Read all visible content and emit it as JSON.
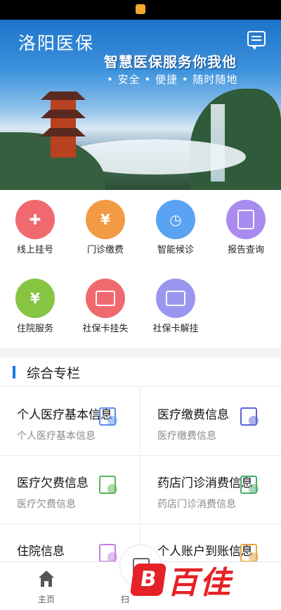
{
  "app": {
    "title": "洛阳医保"
  },
  "banner": {
    "slogan": "智慧医保服务你我他",
    "tags": "• 安全 • 便捷 • 随时随地"
  },
  "services": [
    {
      "label": "线上挂号",
      "icon": "hospital-cross-icon",
      "color": "#f0696f"
    },
    {
      "label": "门诊缴费",
      "icon": "payment-document-icon",
      "color": "#f39a45"
    },
    {
      "label": "智能候诊",
      "icon": "clock-user-icon",
      "color": "#5aa3f2"
    },
    {
      "label": "报告查询",
      "icon": "report-clipboard-icon",
      "color": "#a98bf0"
    },
    {
      "label": "住院服务",
      "icon": "money-bill-icon",
      "color": "#86c442"
    },
    {
      "label": "社保卡挂失",
      "icon": "social-card-lost-icon",
      "color": "#f0696f"
    },
    {
      "label": "社保卡解挂",
      "icon": "social-card-unlock-icon",
      "color": "#9a96f0"
    }
  ],
  "section": {
    "title": "综合专栏",
    "cards": [
      {
        "title": "个人医疗基本信息",
        "subtitle": "个人医疗基本信息",
        "icon": "person-info-icon",
        "color": "#5a8ef2"
      },
      {
        "title": "医疗缴费信息",
        "subtitle": "医疗缴费信息",
        "icon": "monitor-chart-icon",
        "color": "#5b63d6"
      },
      {
        "title": "医疗欠费信息",
        "subtitle": "医疗欠费信息",
        "icon": "edit-document-icon",
        "color": "#58b35a"
      },
      {
        "title": "药店门诊消费信息",
        "subtitle": "药店门诊消费信息",
        "icon": "pharmacy-money-icon",
        "color": "#46ad66"
      },
      {
        "title": "住院信息",
        "subtitle": "",
        "icon": "hospital-bed-icon",
        "color": "#c77be0"
      },
      {
        "title": "个人账户到账信息",
        "subtitle": "",
        "icon": "account-arrow-icon",
        "color": "#e9a23a"
      }
    ]
  },
  "tabbar": {
    "home_label": "主页",
    "scan_label": "扫"
  },
  "watermark": {
    "logo": "B",
    "text": "百佳"
  }
}
